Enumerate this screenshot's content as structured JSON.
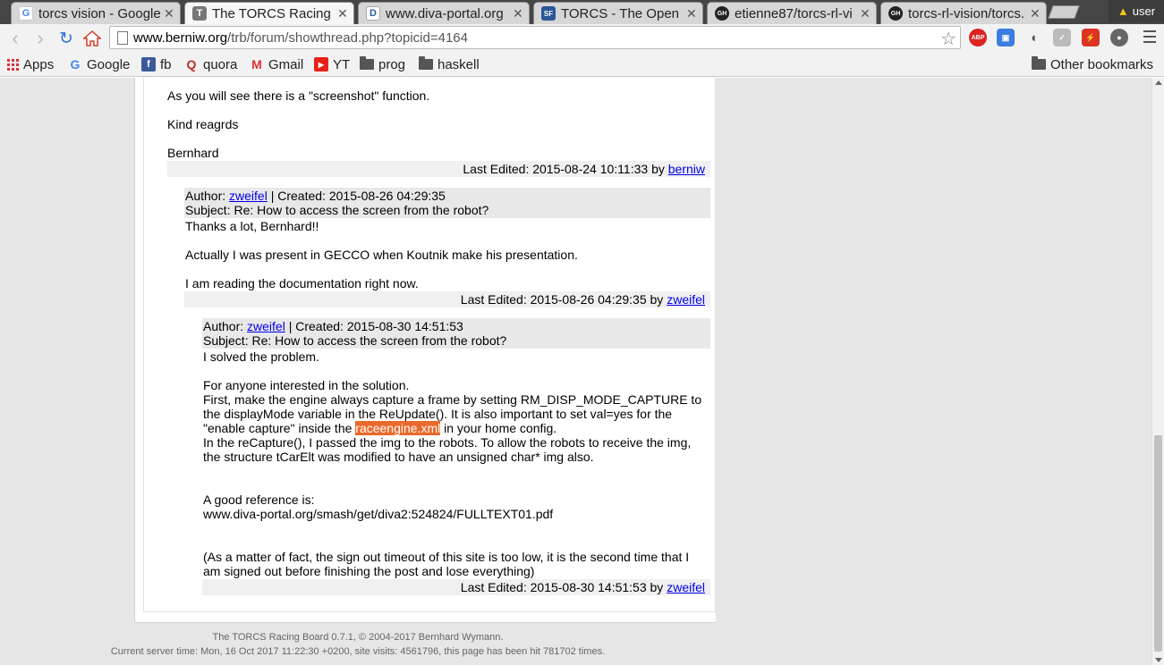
{
  "tabs": [
    {
      "title": "torcs vision - Google",
      "icon": "G"
    },
    {
      "title": "The TORCS Racing Bo",
      "icon": "T"
    },
    {
      "title": "www.diva-portal.org",
      "icon": "D"
    },
    {
      "title": "TORCS - The Open Ra",
      "icon": "SF"
    },
    {
      "title": "etienne87/torcs-rl-vi",
      "icon": "GH"
    },
    {
      "title": "torcs-rl-vision/torcs.",
      "icon": "GH"
    }
  ],
  "profile": {
    "label": "user"
  },
  "address": {
    "host": "www.berniw.org",
    "path": "/trb/forum/showthread.php?topicid=4164"
  },
  "bookmarks": {
    "apps": "Apps",
    "google": "Google",
    "fb": "fb",
    "quora": "quora",
    "gmail": "Gmail",
    "yt": "YT",
    "prog": "prog",
    "haskell": "haskell",
    "other": "Other bookmarks"
  },
  "extensions": {
    "abp": "ABP"
  },
  "post1": {
    "line1": "As you will see there is a \"screenshot\" function.",
    "line2": "Kind reagrds",
    "line3": "Bernhard",
    "edited_prefix": "Last Edited: 2015-08-24 10:11:33 by",
    "edited_user": "berniw"
  },
  "post2": {
    "author_prefix": "Author:",
    "author": "zweifel",
    "created": "| Created: 2015-08-26 04:29:35",
    "subject": "Subject: Re: How to access the screen from the robot?",
    "line1": "Thanks a lot, Bernhard!!",
    "line2": "Actually I was present in GECCO when Koutnik make his presentation.",
    "line3": "I am reading the documentation right now.",
    "edited_prefix": "Last Edited: 2015-08-26 04:29:35 by",
    "edited_user": "zweifel"
  },
  "post3": {
    "author_prefix": "Author:",
    "author": "zweifel",
    "created": "| Created: 2015-08-30 14:51:53",
    "subject": "Subject: Re: How to access the screen from the robot?",
    "line1": "I solved the problem.",
    "line2": "For anyone interested in the solution.",
    "line3": "First, make the engine always capture a frame by setting RM_DISP_MODE_CAPTURE to",
    "line4": "the displayMode variable in the ReUpdate(). It is also important to set val=yes for the",
    "line5a": "\"enable capture\" inside the",
    "line5hl": "raceengine.xml",
    "line5b": "in your home config.",
    "line6": "In the reCapture(), I passed the img to the robots. To allow the robots to receive the img,",
    "line7": "the structure tCarElt was modified to have an unsigned char* img also.",
    "line8": "A good reference is:",
    "line9": "www.diva-portal.org/smash/get/diva2:524824/FULLTEXT01.pdf",
    "line10": "(As a matter of fact, the sign out timeout of this site is too low, it is the second time that I",
    "line11": "am signed out before finishing the post and lose everything)",
    "edited_prefix": "Last Edited: 2015-08-30 14:51:53 by",
    "edited_user": "zweifel"
  },
  "footer": {
    "line1": "The TORCS Racing Board 0.7.1, © 2004-2017 Bernhard Wymann.",
    "line2": "Current server time: Mon, 16 Oct 2017 11:22:30 +0200, site visits: 4561796, this page has been hit 781702 times."
  },
  "colors": {
    "highlight": "#e9692c",
    "link": "#0000ee",
    "header_bar": "#e8e8e8"
  }
}
